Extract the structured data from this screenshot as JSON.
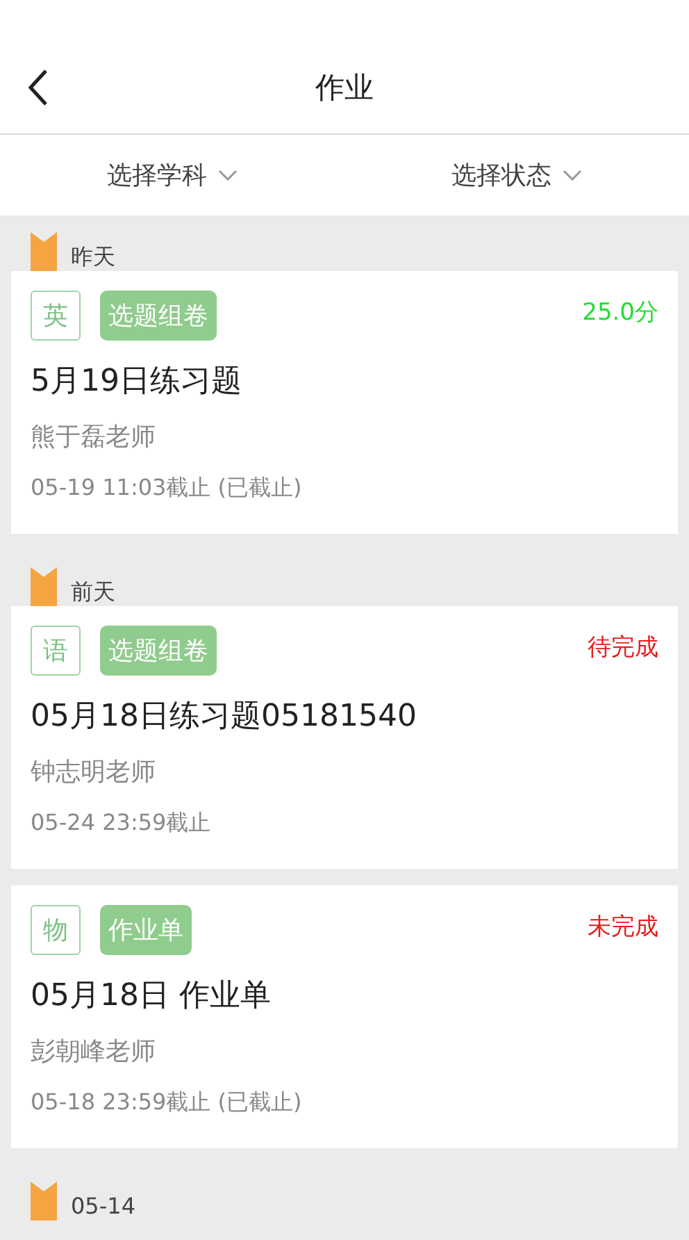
{
  "header": {
    "title": "作业"
  },
  "filters": [
    {
      "label": "选择学科"
    },
    {
      "label": "选择状态"
    }
  ],
  "groups": [
    {
      "label": "昨天",
      "items": [
        {
          "subject": "英",
          "type": "选题组卷",
          "status": {
            "kind": "score",
            "text": "25.0分"
          },
          "title": "5月19日练习题",
          "teacher": "熊于磊老师",
          "deadline": "05-19 11:03截止 (已截止)"
        }
      ]
    },
    {
      "label": "前天",
      "items": [
        {
          "subject": "语",
          "type": "选题组卷",
          "status": {
            "kind": "pending",
            "text": "待完成"
          },
          "title": "05月18日练习题05181540",
          "teacher": "钟志明老师",
          "deadline": "05-24 23:59截止"
        },
        {
          "subject": "物",
          "type": "作业单",
          "status": {
            "kind": "pending",
            "text": "未完成"
          },
          "title": "05月18日 作业单",
          "teacher": "彭朝峰老师",
          "deadline": "05-18 23:59截止 (已截止)"
        }
      ]
    },
    {
      "label": "05-14"
    }
  ]
}
